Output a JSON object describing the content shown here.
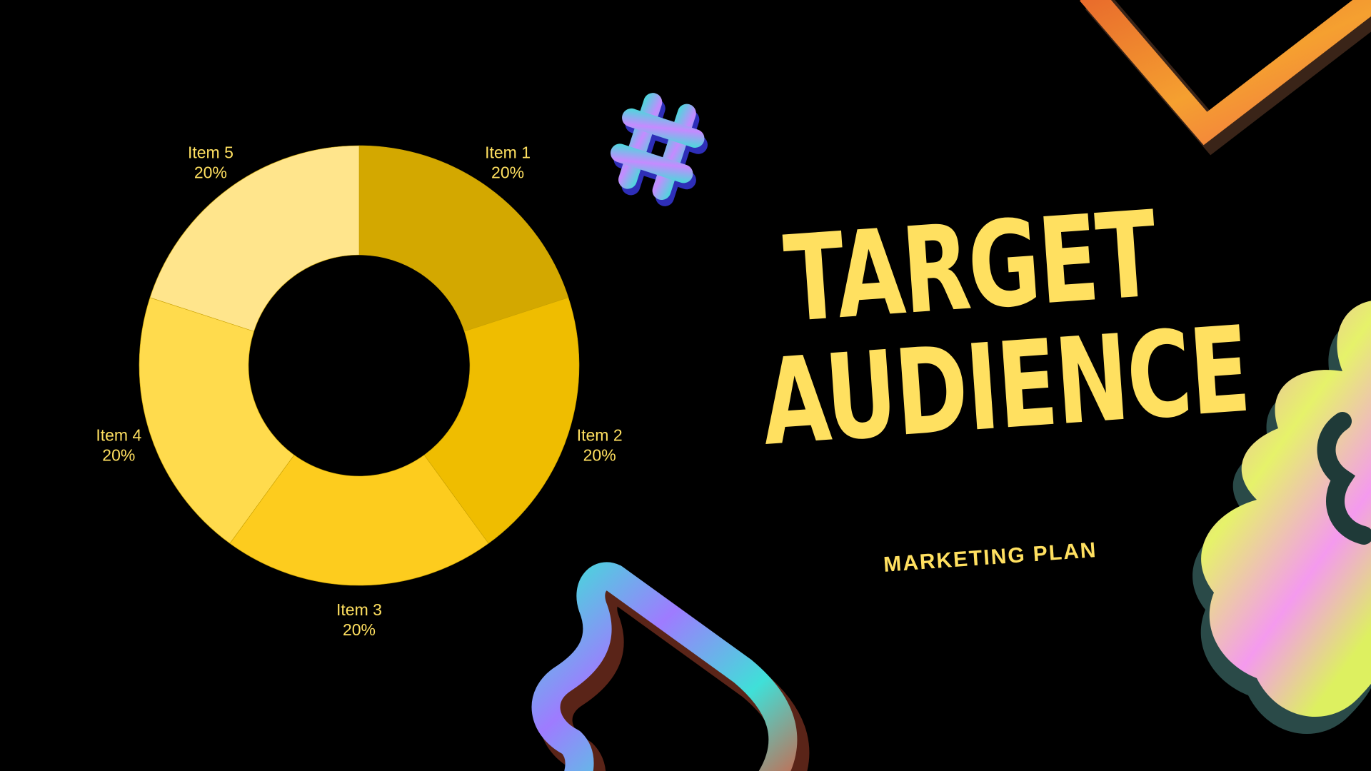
{
  "slide": {
    "title_line_1": "TARGET",
    "title_line_2": "AUDIENCE",
    "subtitle": "MARKETING PLAN"
  },
  "colors": {
    "background": "#000000",
    "title": "#FFE060",
    "subtitle": "#FFE060",
    "label": "#FFE060"
  },
  "chart_data": {
    "type": "pie",
    "donut": true,
    "start_angle_deg": 0,
    "direction": "clockwise",
    "slices": [
      {
        "label": "Item 1",
        "value": 20,
        "percent_label": "20%",
        "color": "#D3A800"
      },
      {
        "label": "Item 2",
        "value": 20,
        "percent_label": "20%",
        "color": "#EFBD00"
      },
      {
        "label": "Item 3",
        "value": 20,
        "percent_label": "20%",
        "color": "#FDCC1E"
      },
      {
        "label": "Item 4",
        "value": 20,
        "percent_label": "20%",
        "color": "#FFDB4D"
      },
      {
        "label": "Item 5",
        "value": 20,
        "percent_label": "20%",
        "color": "#FFE58C"
      }
    ]
  },
  "decorations": [
    {
      "name": "hashtag-shape",
      "colors": [
        "#3FE0D8",
        "#B97CFF",
        "#3A3AD0"
      ]
    },
    {
      "name": "chevron-shape",
      "colors": [
        "#F5C030",
        "#E86A2C",
        "#3A2418"
      ]
    },
    {
      "name": "wavy-blob-shape",
      "colors": [
        "#F27CE8",
        "#DFF25A",
        "#2A4A48"
      ]
    },
    {
      "name": "squiggle-loop-shape",
      "colors": [
        "#3FE0D8",
        "#9E7BFF",
        "#D65E3A"
      ]
    }
  ]
}
